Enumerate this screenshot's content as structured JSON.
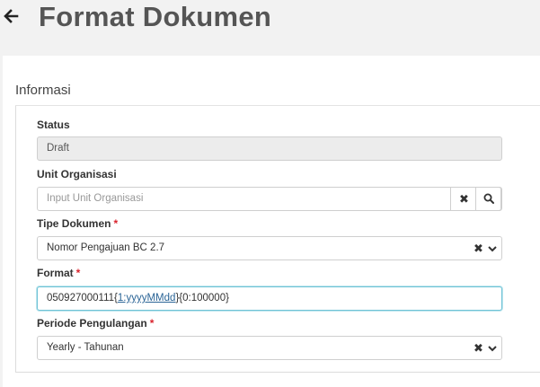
{
  "header": {
    "title": "Format Dokumen",
    "back_icon": "arrow-left-icon"
  },
  "section": {
    "title": "Informasi"
  },
  "form": {
    "status": {
      "label": "Status",
      "value": "Draft"
    },
    "unit_organisasi": {
      "label": "Unit Organisasi",
      "placeholder": "Input Unit Organisasi",
      "clear_icon": "close-icon",
      "search_icon": "search-icon"
    },
    "tipe_dokumen": {
      "label": "Tipe Dokumen",
      "required_mark": "*",
      "value": "Nomor Pengajuan BC 2.7"
    },
    "format": {
      "label": "Format",
      "required_mark": "*",
      "value_prefix": "050927000111",
      "token_open": "{",
      "token_date": "1:yyyyMMdd",
      "token_close": "}",
      "value_suffix": "{0:100000}"
    },
    "periode_pengulangan": {
      "label": "Periode Pengulangan",
      "required_mark": "*",
      "value": "Yearly - Tahunan"
    }
  },
  "colors": {
    "required": "#d9232d",
    "focus_border": "#6fc3d6",
    "link": "#2a6496"
  }
}
